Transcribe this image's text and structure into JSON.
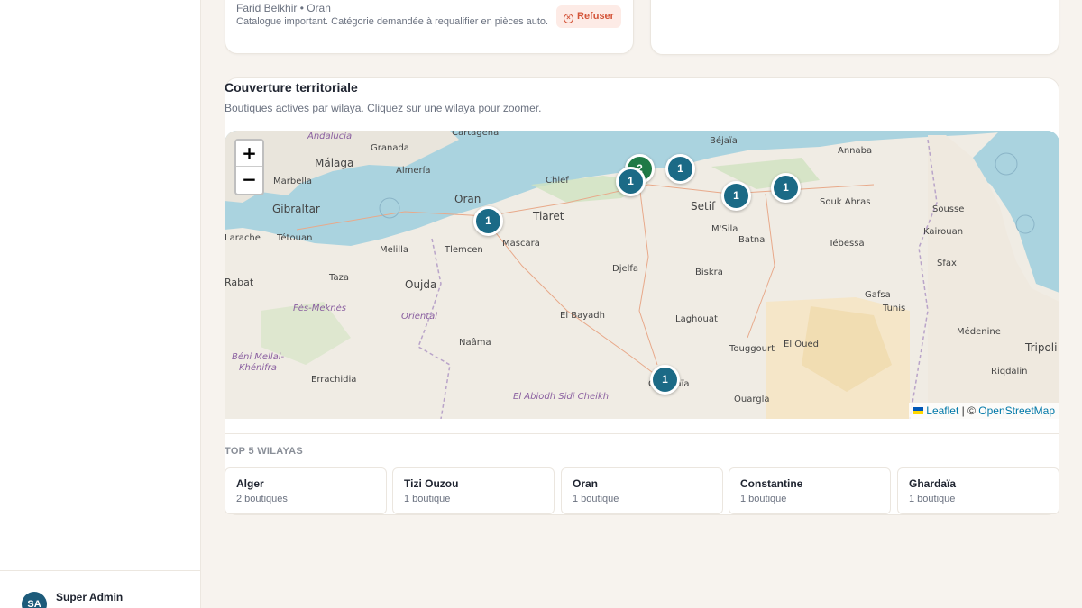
{
  "request": {
    "meta": "Farid Belkhir • Oran",
    "description": "Catalogue important. Catégorie demandée à requalifier en pièces auto.",
    "refuse_label": "Refuser"
  },
  "coverage": {
    "title": "Couverture territoriale",
    "subtitle": "Boutiques actives par wilaya. Cliquez sur une wilaya pour zoomer.",
    "zoom_in": "+",
    "zoom_out": "−",
    "attribution_leaflet": "Leaflet",
    "attribution_sep": "| ©",
    "attribution_osm": "OpenStreetMap",
    "markers": [
      {
        "name": "Alger-cluster",
        "count": "2",
        "color": "#1f7a46"
      },
      {
        "name": "Alger",
        "count": "1",
        "color": "#1b6a86"
      },
      {
        "name": "Tizi Ouzou",
        "count": "1",
        "color": "#1b6a86"
      },
      {
        "name": "Setif",
        "count": "1",
        "color": "#1b6a86"
      },
      {
        "name": "Constantine",
        "count": "1",
        "color": "#1b6a86"
      },
      {
        "name": "Oran",
        "count": "1",
        "color": "#1b6a86"
      },
      {
        "name": "Ghardaia",
        "count": "1",
        "color": "#1b6a86"
      }
    ],
    "map_labels": [
      "Andalucía",
      "Granada",
      "Cartagena",
      "Málaga",
      "Almería",
      "Marbella",
      "Gibraltar",
      "Tétouan",
      "Larache",
      "Melilla",
      "Taza",
      "Oujda",
      "Oran",
      "Tlemcen",
      "Mascara",
      "Tiaret",
      "Chlef",
      "Béjaïa",
      "Setif",
      "M'Sila",
      "Batna",
      "Biskra",
      "Tébessa",
      "Annaba",
      "Souk Ahras",
      "Kairouan",
      "Sfax",
      "Sousse",
      "Tunis",
      "Gafsa",
      "Tripoli",
      "Riqdalin",
      "Médenine",
      "Rabat",
      "Fès-Meknès",
      "Oriental",
      "Béni Mellal-Khénifra",
      "Errachidia",
      "Laghouat",
      "Djelfa",
      "El Bayadh",
      "Naâma",
      "Ouargla",
      "El Oued",
      "Touggourt",
      "Ghardaïa",
      "El Abiodh Sidi Cheikh"
    ],
    "top5_label": "TOP 5 WILAYAS",
    "top5": [
      {
        "name": "Alger",
        "count": "2 boutiques"
      },
      {
        "name": "Tizi Ouzou",
        "count": "1 boutique"
      },
      {
        "name": "Oran",
        "count": "1 boutique"
      },
      {
        "name": "Constantine",
        "count": "1 boutique"
      },
      {
        "name": "Ghardaïa",
        "count": "1 boutique"
      }
    ]
  },
  "user": {
    "initials": "SA",
    "name": "Super Admin"
  }
}
